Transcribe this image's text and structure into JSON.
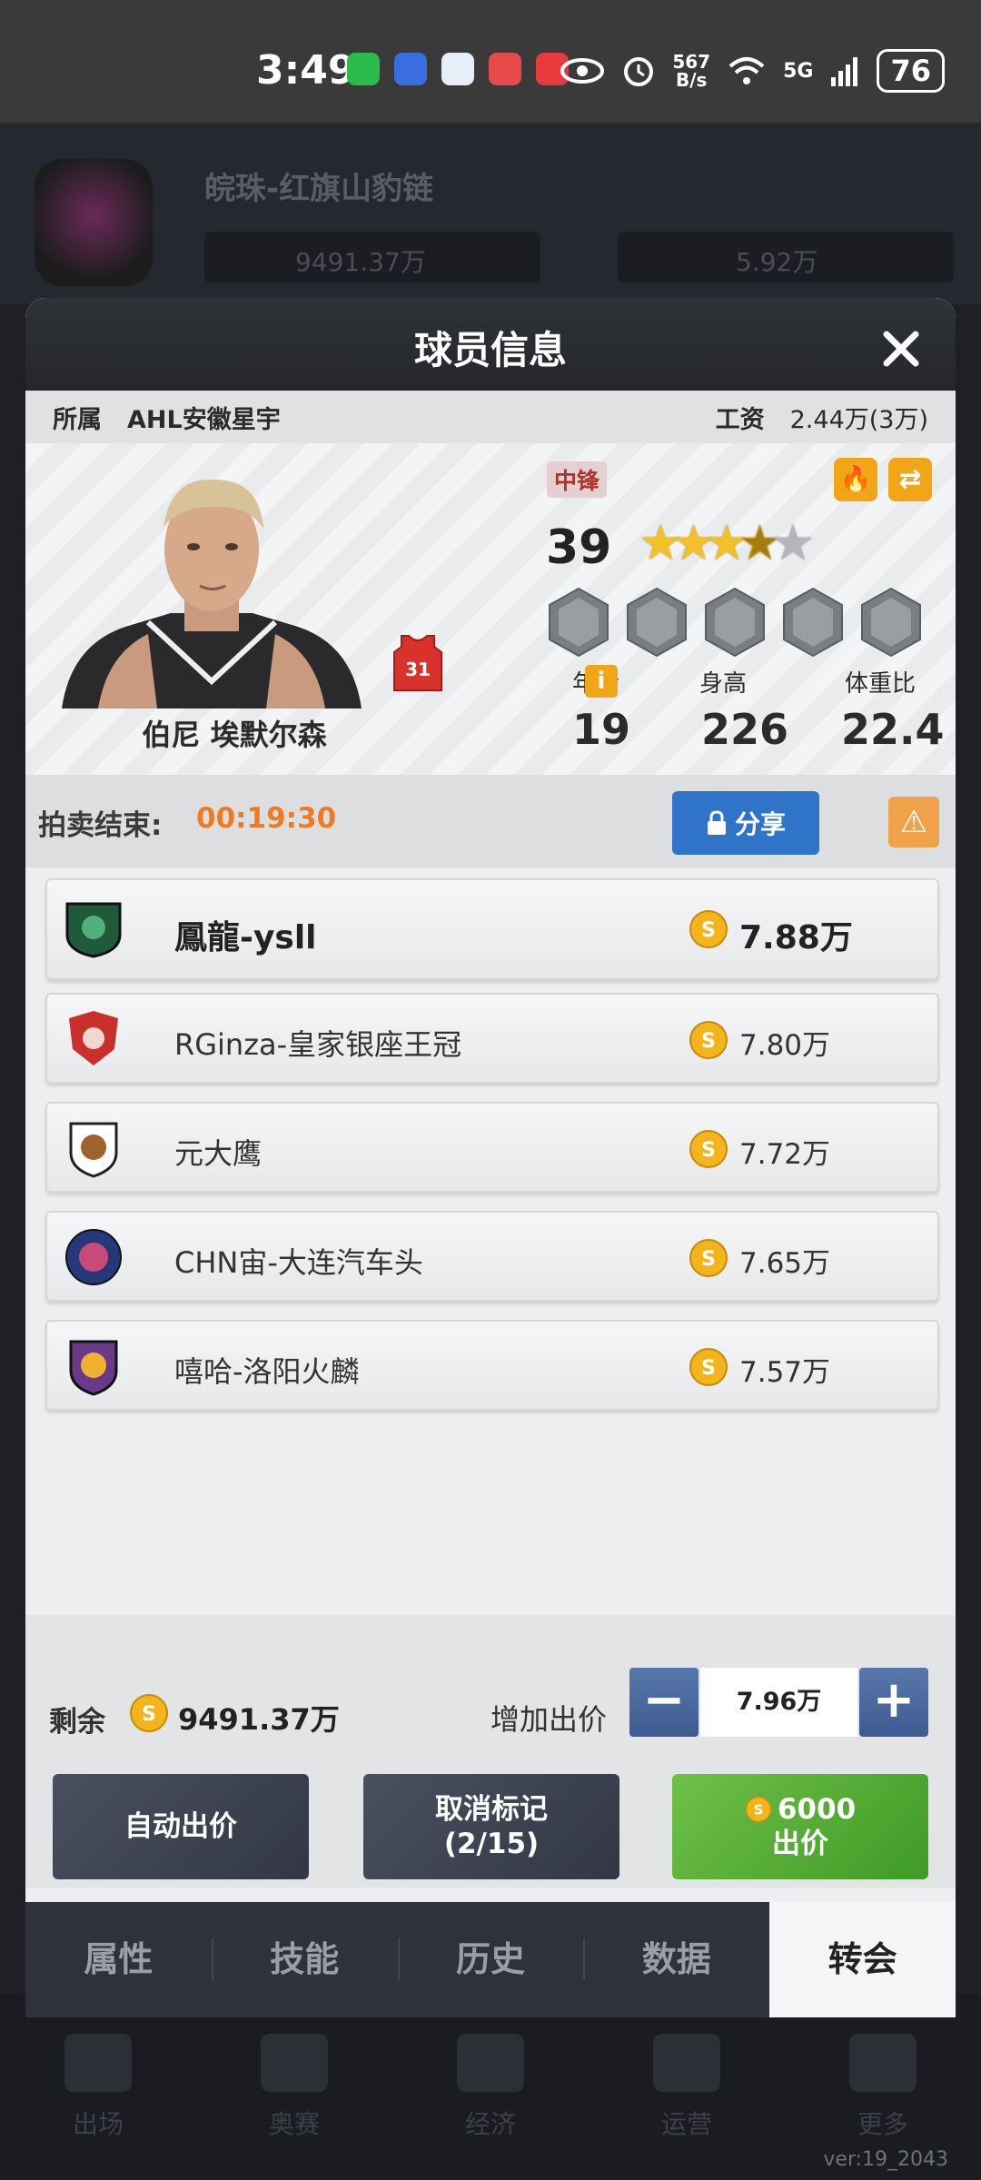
{
  "status_bar": {
    "time": "3:49",
    "net_speed_value": "567",
    "net_speed_unit": "B/s",
    "network": "5G",
    "battery": "76"
  },
  "background": {
    "team_title": "皖珠-红旗山豹链",
    "resource_1": "9491.37万",
    "resource_2": "5.92万",
    "nav": [
      "出场",
      "奥赛",
      "经济",
      "运营",
      "更多"
    ],
    "version": "ver:19_2043"
  },
  "dialog": {
    "title": "球员信息",
    "club_label": "所属",
    "club": "AHL安徽星宇",
    "salary_label": "工资",
    "salary": "2.44万(3万)"
  },
  "player": {
    "name": "伯尼 埃默尔森",
    "jersey_number": "31",
    "position": "中锋",
    "rating": "39",
    "stars_total": 5,
    "stars_filled": 3.5,
    "age_label": "年龄",
    "height_label": "身高",
    "weight_label": "体重比",
    "age": "19",
    "height": "226",
    "weight_ratio": "22.4"
  },
  "auction": {
    "end_label": "拍卖结束:",
    "time_left": "00:19:30",
    "share_label": "分享"
  },
  "bids": [
    {
      "team": "鳳龍-ysll",
      "amount": "7.88万",
      "highlight": true
    },
    {
      "team": "RGinza-皇家银座王冠",
      "amount": "7.80万",
      "highlight": false
    },
    {
      "team": "元大鹰",
      "amount": "7.72万",
      "highlight": false
    },
    {
      "team": "CHN宙-大连汽车头",
      "amount": "7.65万",
      "highlight": false
    },
    {
      "team": "嘻哈-洛阳火麟",
      "amount": "7.57万",
      "highlight": false
    }
  ],
  "controls": {
    "remaining_label": "剩余",
    "remaining": "9491.37万",
    "raise_label": "增加出价",
    "raise_value": "7.96万",
    "minus": "−",
    "plus": "+",
    "auto_bid": "自动出价",
    "cancel_mark_line1": "取消标记",
    "cancel_mark_line2": "(2/15)",
    "bid_cost": "6000",
    "bid_label": "出价"
  },
  "tabs": [
    "属性",
    "技能",
    "历史",
    "数据",
    "转会"
  ],
  "active_tab": "转会",
  "colors": {
    "accent_orange": "#f07a22",
    "share_blue": "#2f74c9",
    "bid_green": "#4faa2f",
    "warning_orange": "#f0a24a"
  }
}
